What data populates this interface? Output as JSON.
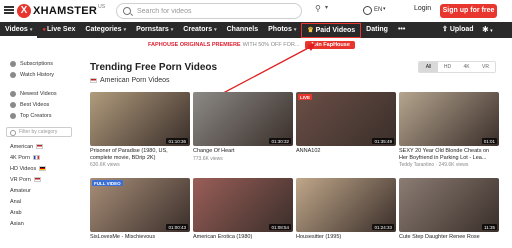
{
  "header": {
    "logo_letter": "X",
    "logo_text": "XHAMSTER",
    "logo_region": "US",
    "search_placeholder": "Search for videos",
    "language": "EN",
    "login_label": "Login",
    "signup_label": "Sign up for free"
  },
  "nav": {
    "items": [
      "Videos",
      "Live Sex",
      "Categories",
      "Pornstars",
      "Creators",
      "Channels",
      "Photos",
      "Paid Videos",
      "Dating",
      "•••"
    ],
    "upload_label": "Upload",
    "accent": "#e8362e"
  },
  "promo": {
    "text": "FAPHOUSE ORIGINALS PREMIERE",
    "text2": "WITH 50% OFF FOR...",
    "button": "Join FapHouse"
  },
  "sidebar": {
    "items": [
      "Subscriptions",
      "Watch History",
      "Newest Videos",
      "Best Videos",
      "Top Creators"
    ],
    "filter_placeholder": "Filter by category",
    "categories": [
      "American",
      "4K Porn",
      "HD Videos",
      "VR Porn",
      "Amateur",
      "Anal",
      "Arab",
      "Asian"
    ]
  },
  "main": {
    "title": "Trending Free Porn Videos",
    "subtitle": "American Porn Videos",
    "quality": [
      "All",
      "HD",
      "4K",
      "VR"
    ]
  },
  "videos": [
    {
      "title": "Prisoner of Paradise (1980, US, complete movie, BDrip 2K)",
      "meta": "630.6K views",
      "duration": "01:10:36",
      "color": "#b09b7c",
      "badge": ""
    },
    {
      "title": "Change Of Heart",
      "meta": "773.6K views",
      "duration": "01:30:32",
      "color": "#8c8a86",
      "badge": ""
    },
    {
      "title": "ANNA102",
      "meta": "",
      "duration": "01:35:49",
      "color": "#6b4f46",
      "badge": "LIVE"
    },
    {
      "title": "SEXY 20 Year Old Blonde Cheats on Her Boyfriend in Parking Lot - Lea...",
      "meta": "Teddy Tarantino · 249.6K views",
      "duration": "01:01",
      "color": "#b5a58f",
      "badge": ""
    },
    {
      "title": "SisLovesMe - Mischievous",
      "meta": "",
      "duration": "01:00:43",
      "color": "#a88e78",
      "badge": "FULL VIDEO"
    },
    {
      "title": "American Erotica (1980)",
      "meta": "",
      "duration": "01:08:54",
      "color": "#9a5e58",
      "badge": ""
    },
    {
      "title": "Housesitter (1995)",
      "meta": "",
      "duration": "01:24:33",
      "color": "#c0a78a",
      "badge": ""
    },
    {
      "title": "Cute Step Daughter Renee Rose",
      "meta": "",
      "duration": "11:35",
      "color": "#8b7d73",
      "badge": ""
    }
  ]
}
